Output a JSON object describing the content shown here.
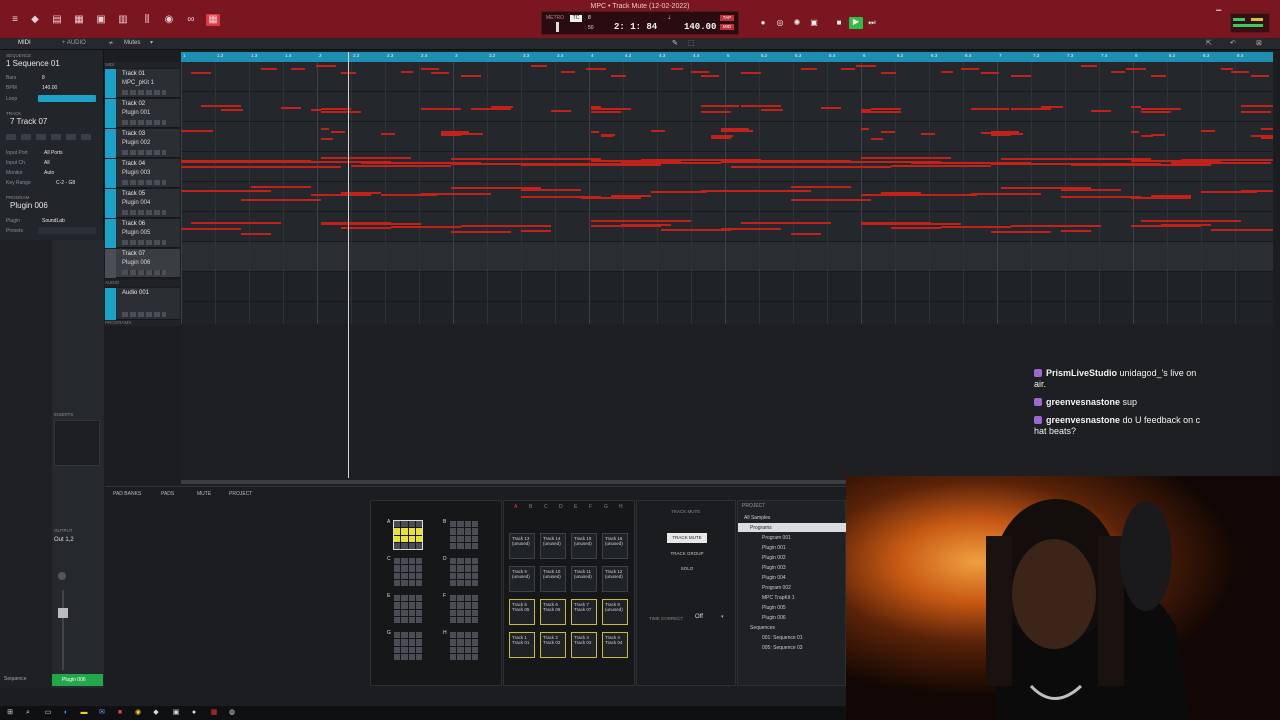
{
  "window": {
    "title": "MPC • Track Mute (12-02-2022)"
  },
  "transport": {
    "metro_label": "METRO",
    "tc_label": "TC",
    "tc_value": "8",
    "tc_sub": "50",
    "position": "2: 1: 84",
    "bpm": "140.00",
    "tap_label": "TAP",
    "mid_label": "MID",
    "loop_label": "L",
    "colors": {
      "bar": "#7a1620",
      "play": "#2fbf45"
    }
  },
  "modebar": {
    "midi": "MIDI",
    "audio": "+ AUDIO",
    "mute_label": "Mutes"
  },
  "left_panel": {
    "sequence_label": "SEQUENCE",
    "sequence_name": "1 Sequence 01",
    "bars_label": "Bars",
    "bars_value": "8",
    "bpm_label": "BPM",
    "bpm_value": "140.00",
    "loop_label": "Loop",
    "track_label": "TRACK",
    "track_name": "7 Track 07",
    "input_port_label": "Input Port",
    "input_port_value": "All Ports",
    "input_ch_label": "Input Ch.",
    "input_ch_value": "All",
    "monitor_label": "Monitor",
    "monitor_value": "Auto",
    "key_range_label": "Key Range",
    "key_range_value": "C-2 - G8",
    "program_label": "PROGRAM",
    "program_name": "Plugin 006",
    "plugin_label": "Plugin",
    "plugin_value": "SoundLab",
    "presets_label": "Presets",
    "inserts_label": "INSERTS",
    "output_label": "OUTPUT",
    "output_value": "Out 1,2",
    "strip_left": "Sequence",
    "strip_right": "Plugin 006"
  },
  "sections": {
    "midi": "MIDI",
    "audio": "AUDIO",
    "programs": "PROGRAMS"
  },
  "tracks": [
    {
      "name": "Track 01",
      "program": "MPC_pKit 1"
    },
    {
      "name": "Track 02",
      "program": "Plugin 001"
    },
    {
      "name": "Track 03",
      "program": "Plugin 002"
    },
    {
      "name": "Track 04",
      "program": "Plugin 003"
    },
    {
      "name": "Track 05",
      "program": "Plugin 004"
    },
    {
      "name": "Track 06",
      "program": "Plugin 005"
    },
    {
      "name": "Track 07",
      "program": "Plugin 006"
    }
  ],
  "audio_tracks": [
    {
      "name": "Audio 001"
    }
  ],
  "ruler": {
    "ticks": [
      "1",
      "1.2",
      "1.3",
      "1.4",
      "2",
      "2.2",
      "2.3",
      "2.4",
      "3",
      "3.2",
      "3.3",
      "3.4",
      "4",
      "4.2",
      "4.3",
      "4.4",
      "5",
      "5.2",
      "5.3",
      "5.4",
      "6",
      "6.2",
      "6.3",
      "6.4",
      "7",
      "7.2",
      "7.3",
      "7.4",
      "8",
      "8.2",
      "8.3",
      "8.4"
    ]
  },
  "bottom_tabs": [
    "PAD BANKS",
    "PADS",
    "MUTE",
    "PROJECT"
  ],
  "pad_banks": [
    {
      "label": "A",
      "active": true
    },
    {
      "label": "B",
      "active": false
    },
    {
      "label": "C",
      "active": false
    },
    {
      "label": "D",
      "active": false
    },
    {
      "label": "E",
      "active": false
    },
    {
      "label": "F",
      "active": false
    },
    {
      "label": "G",
      "active": false
    },
    {
      "label": "H",
      "active": false
    }
  ],
  "mute_bank_letters": [
    "A",
    "B",
    "C",
    "D",
    "E",
    "F",
    "G",
    "H"
  ],
  "mute_pads": [
    {
      "a": "Track 13",
      "b": "(unused)"
    },
    {
      "a": "Track 14",
      "b": "(unused)"
    },
    {
      "a": "Track 15",
      "b": "(unused)"
    },
    {
      "a": "Track 16",
      "b": "(unused)"
    },
    {
      "a": "Track 9",
      "b": "(unused)"
    },
    {
      "a": "Track 10",
      "b": "(unused)"
    },
    {
      "a": "Track 11",
      "b": "(unused)"
    },
    {
      "a": "Track 12",
      "b": "(unused)"
    },
    {
      "a": "Track 5",
      "b": "Track 05"
    },
    {
      "a": "Track 6",
      "b": "Track 06"
    },
    {
      "a": "Track 7",
      "b": "Track 07"
    },
    {
      "a": "Track 8",
      "b": "(unused)"
    },
    {
      "a": "Track 1",
      "b": "Track 01"
    },
    {
      "a": "Track 2",
      "b": "Track 02"
    },
    {
      "a": "Track 3",
      "b": "Track 03"
    },
    {
      "a": "Track 4",
      "b": "Track 04"
    }
  ],
  "mute_controls": {
    "header": "TRACK MUTE",
    "track_mute": "TRACK MUTE",
    "track_group": "TRACK GROUP",
    "solo": "SOLO",
    "time_correct_label": "TIME CORRECT",
    "time_correct_value": "Off"
  },
  "project": {
    "header": "PROJECT",
    "all_samples": "All Samples",
    "programs": "Programs",
    "items": [
      "Program 001",
      "Plugin 001",
      "Plugin 002",
      "Plugin 003",
      "Plugin 004",
      "Program 002",
      "MPC TrapKit 1",
      "Plugin 005",
      "Plugin 006"
    ],
    "sequences": "Sequences",
    "seq_items": [
      "001: Sequence 01",
      "005: Sequence 03"
    ]
  },
  "chat": [
    {
      "user": "PrismLiveStudio",
      "msg": "unidagod_'s live on air."
    },
    {
      "user": "greenvesnastone",
      "msg": "sup"
    },
    {
      "user": "greenvesnastone",
      "msg": "do U feedback on c hat beats?"
    }
  ],
  "note_color": "#c3221b"
}
